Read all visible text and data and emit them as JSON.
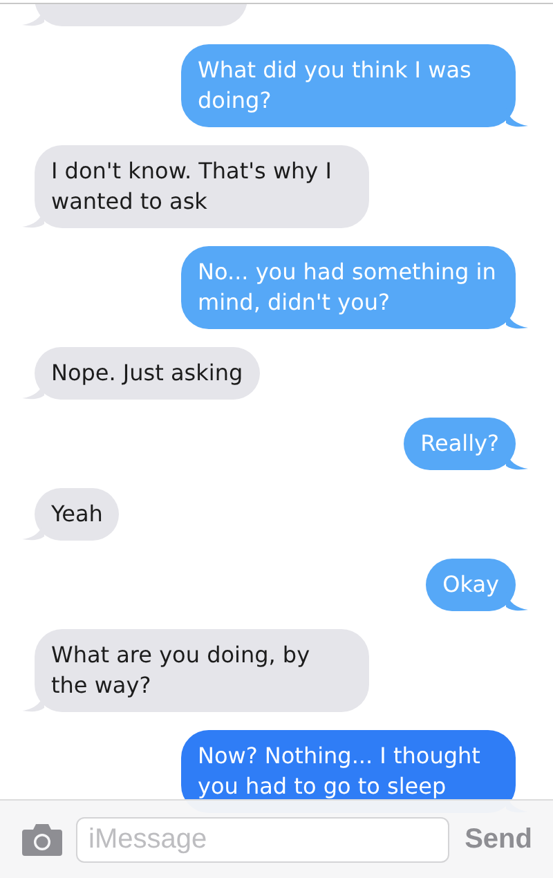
{
  "messages": [
    {
      "kind": "received",
      "color": "#e5e5ea"
    },
    {
      "kind": "sent",
      "text": "What did you think I was doing?",
      "color": "#56a8f7"
    },
    {
      "kind": "received",
      "text": "I don't know. That's why I wanted to ask",
      "color": "#e5e5ea"
    },
    {
      "kind": "sent",
      "text": "No... you had something in mind, didn't you?",
      "color": "#56a8f7"
    },
    {
      "kind": "received",
      "text": "Nope. Just asking",
      "color": "#e5e5ea"
    },
    {
      "kind": "sent",
      "text": "Really?",
      "color": "#56a8f7"
    },
    {
      "kind": "received",
      "text": "Yeah",
      "color": "#e5e5ea"
    },
    {
      "kind": "sent",
      "text": "Okay",
      "color": "#56a8f7"
    },
    {
      "kind": "received",
      "text": "What are you doing, by the way?",
      "color": "#e5e5ea"
    },
    {
      "kind": "sent",
      "text": "Now? Nothing... I thought you had to go to sleep",
      "color": "#2f7df6"
    }
  ],
  "composer": {
    "placeholder": "iMessage",
    "send": "Send"
  }
}
